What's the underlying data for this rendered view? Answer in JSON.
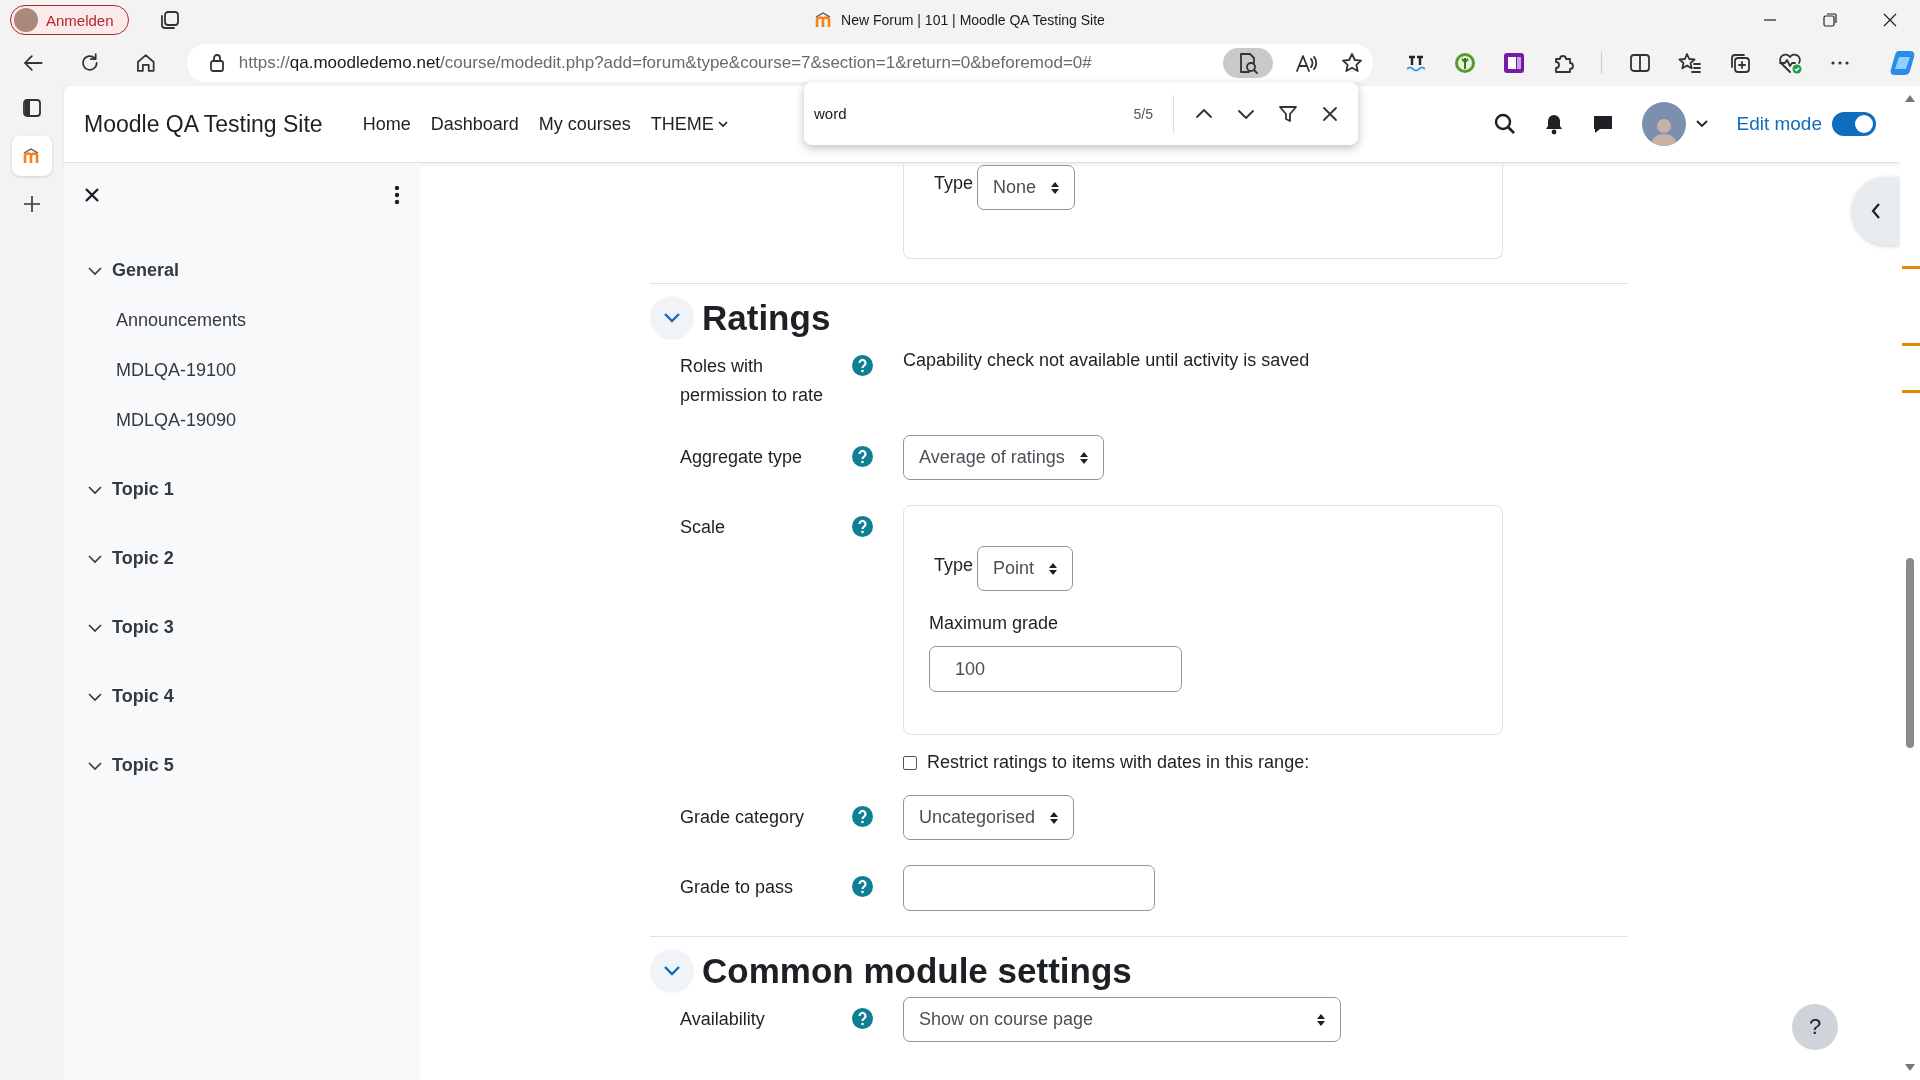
{
  "browser": {
    "profile_button": "Anmelden",
    "tab_title": "New Forum | 101 | Moodle QA Testing Site",
    "url": {
      "scheme": "https://",
      "host": "qa.moodledemo.net",
      "path": "/course/modedit.php?add=forum&type&course=7&section=1&return=0&beforemod=0#"
    },
    "find": {
      "query": "word",
      "count": "5/5"
    }
  },
  "navbar": {
    "site_name": "Moodle QA Testing Site",
    "links": [
      {
        "label": "Home",
        "dropdown": false
      },
      {
        "label": "Dashboard",
        "dropdown": false
      },
      {
        "label": "My courses",
        "dropdown": false
      },
      {
        "label": "THEME",
        "dropdown": true
      }
    ],
    "edit_mode": {
      "label": "Edit mode",
      "on": true
    }
  },
  "course_index": {
    "sections": [
      {
        "title": "General",
        "expanded": true,
        "items": [
          "Announcements",
          "MDLQA-19100",
          "MDLQA-19090"
        ]
      },
      {
        "title": "Topic 1",
        "expanded": true
      },
      {
        "title": "Topic 2",
        "expanded": true
      },
      {
        "title": "Topic 3",
        "expanded": true
      },
      {
        "title": "Topic 4",
        "expanded": true
      },
      {
        "title": "Topic 5",
        "expanded": true
      }
    ]
  },
  "form": {
    "previous_box": {
      "type_label": "Type",
      "type_value": "None"
    },
    "sections": [
      {
        "title": "Ratings",
        "expanded": true,
        "rows": [
          {
            "kind": "static",
            "label": "Roles with permission to rate",
            "value": "Capability check not available until activity is saved"
          },
          {
            "kind": "select",
            "label": "Aggregate type",
            "value": "Average of ratings"
          },
          {
            "kind": "scale",
            "label": "Scale",
            "type_label": "Type",
            "type_value": "Point",
            "max_label": "Maximum grade",
            "max_value": "100"
          },
          {
            "kind": "checkbox",
            "label": "Restrict ratings to items with dates in this range:",
            "checked": false
          },
          {
            "kind": "select",
            "label": "Grade category",
            "value": "Uncategorised"
          },
          {
            "kind": "text",
            "label": "Grade to pass"
          }
        ]
      },
      {
        "title": "Common module settings",
        "expanded": true,
        "rows": [
          {
            "kind": "select",
            "label": "Availability",
            "value": "Show on course page",
            "wide": true
          }
        ]
      }
    ]
  },
  "help_button": "?"
}
